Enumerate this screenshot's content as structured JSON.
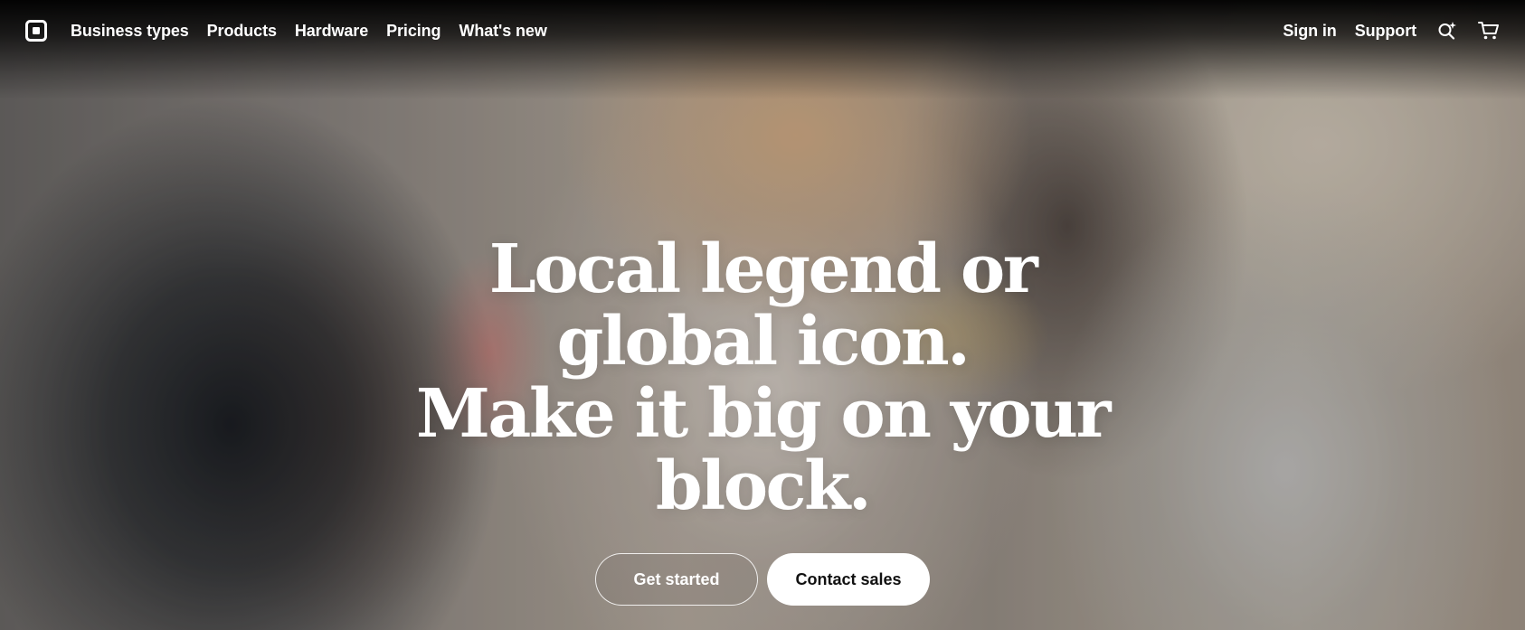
{
  "nav": {
    "logo_icon": "square-logo-icon",
    "links": [
      "Business types",
      "Products",
      "Hardware",
      "Pricing",
      "What's new"
    ],
    "sign_in": "Sign in",
    "support": "Support",
    "search_icon": "search-sparkle-icon",
    "cart_icon": "cart-icon"
  },
  "hero": {
    "headline_lines": [
      "Local legend or",
      "global icon.",
      "Make it big on your",
      "block."
    ],
    "primary_cta": "Get started",
    "secondary_cta": "Contact sales"
  },
  "colors": {
    "text": "#ffffff",
    "solid_button_bg": "#ffffff",
    "solid_button_text": "#111111"
  }
}
